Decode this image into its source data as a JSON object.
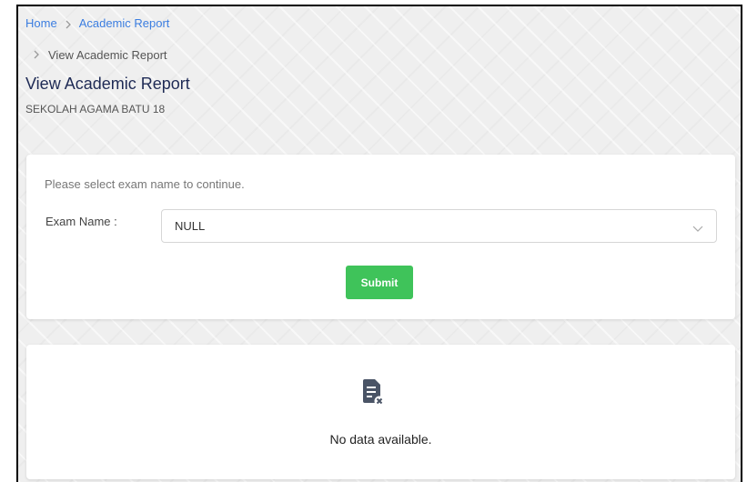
{
  "breadcrumb": {
    "home": "Home",
    "academic_report": "Academic Report",
    "view_academic_report": "View Academic Report"
  },
  "header": {
    "title": "View Academic Report",
    "school": "SEKOLAH AGAMA BATU 18"
  },
  "form": {
    "instruction": "Please select exam name to continue.",
    "exam_label": "Exam Name :",
    "exam_selected": "NULL",
    "submit_label": "Submit"
  },
  "empty_state": {
    "message": "No data available.",
    "icon": "no-data-icon"
  },
  "colors": {
    "link": "#3b7de0",
    "title": "#1e2a55",
    "submit": "#3fc35a",
    "icon": "#4a5466"
  }
}
